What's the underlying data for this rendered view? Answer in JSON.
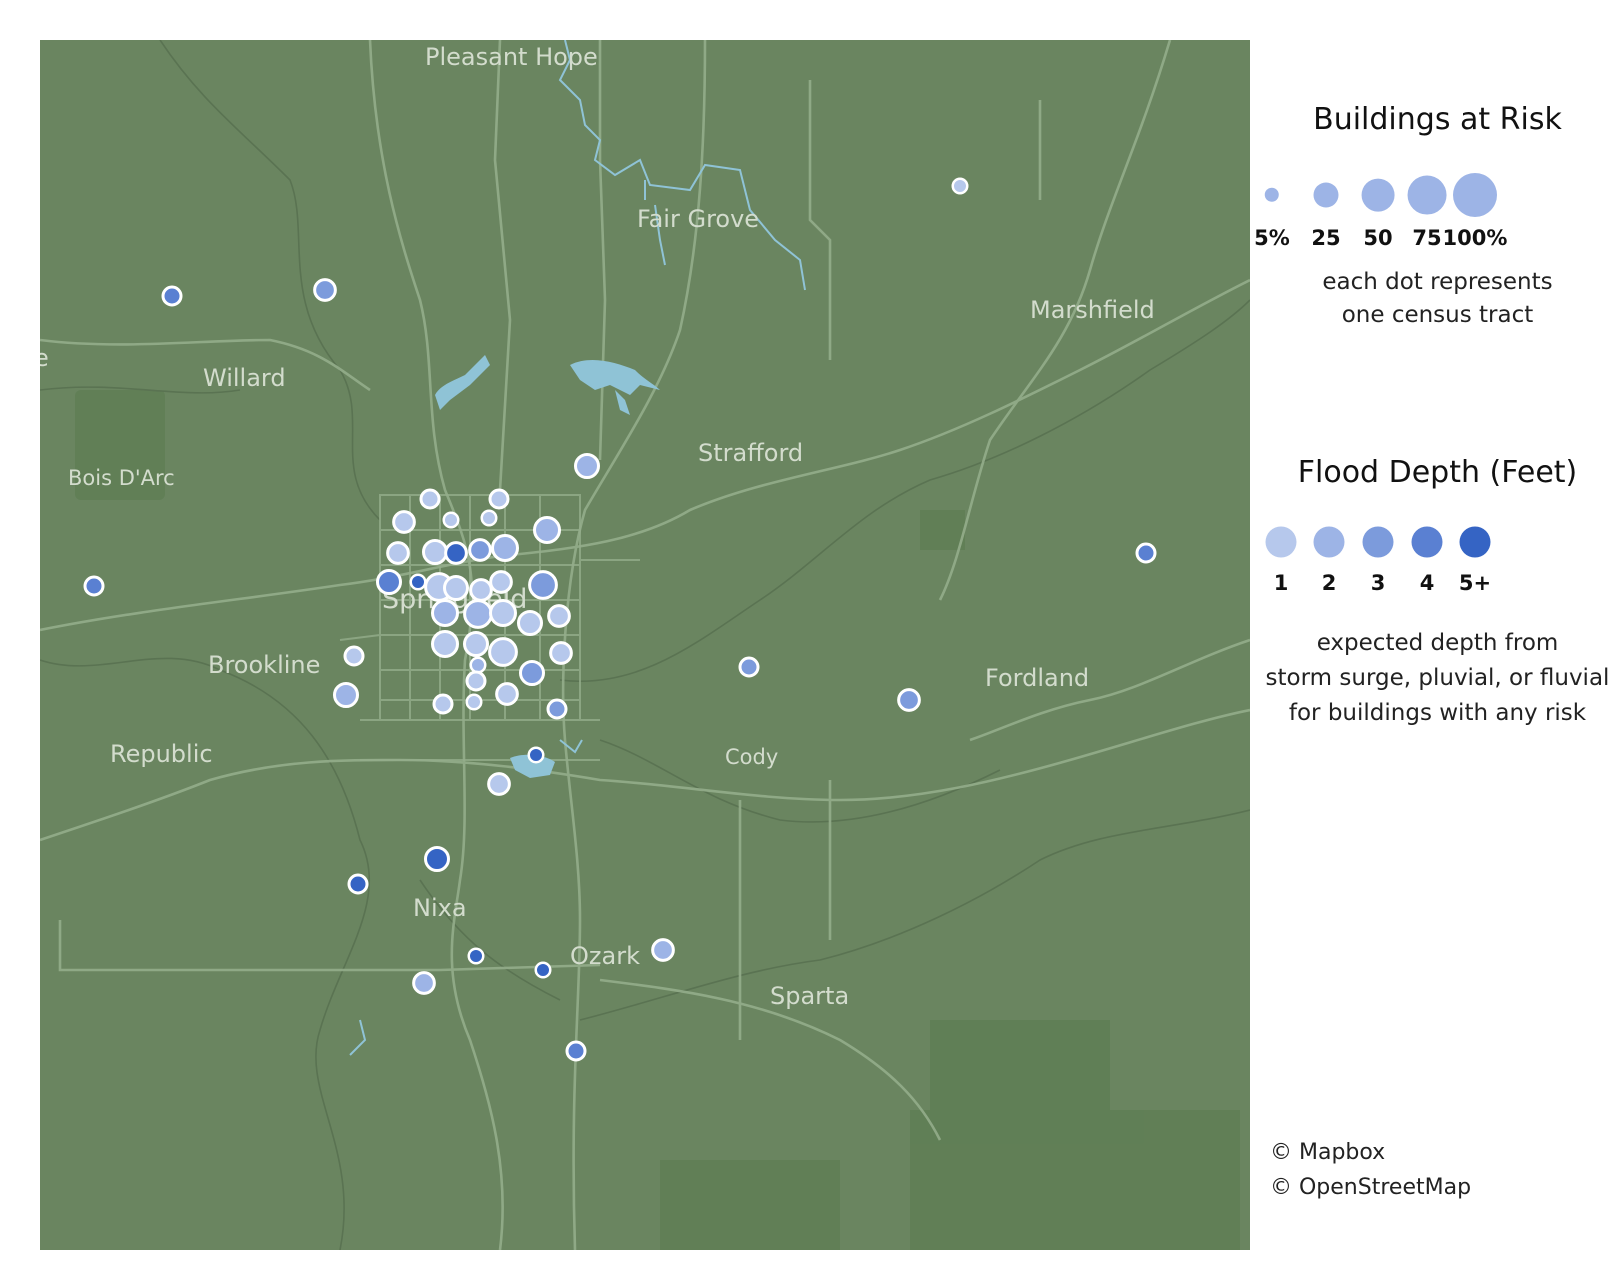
{
  "towns": [
    {
      "name": "Pleasant Hope"
    },
    {
      "name": "Fair Grove"
    },
    {
      "name": "Marshfield"
    },
    {
      "name": "Willard"
    },
    {
      "name": "Bois D'Arc"
    },
    {
      "name": "Strafford"
    },
    {
      "name": "Springfield"
    },
    {
      "name": "Brookline"
    },
    {
      "name": "Republic"
    },
    {
      "name": "Fordland"
    },
    {
      "name": "Cody"
    },
    {
      "name": "Nixa"
    },
    {
      "name": "Ozark"
    },
    {
      "name": "Sparta"
    },
    {
      "name": "e"
    }
  ],
  "map": {
    "background_color": "#6a8560",
    "road_color": "#9fb597",
    "water_color": "#8fc3d6",
    "park_color": "#5f7e55"
  },
  "legend": {
    "size": {
      "title": "Buildings at Risk",
      "labels": [
        "5%",
        "25",
        "50",
        "75",
        "100%"
      ],
      "values": [
        5,
        25,
        50,
        75,
        100
      ],
      "note_line1": "each dot represents",
      "note_line2": "one census tract"
    },
    "depth": {
      "title": "Flood Depth (Feet)",
      "labels": [
        "1",
        "2",
        "3",
        "4",
        "5+"
      ],
      "colors": [
        "#b6c8ec",
        "#9db4e6",
        "#7c9bdc",
        "#5a80d2",
        "#3564c4"
      ],
      "note_line1": "expected depth from",
      "note_line2": "storm surge, pluvial, or fluvial",
      "note_line3": "for buildings with any risk"
    }
  },
  "credits": {
    "mapbox": "© Mapbox",
    "osm": "© OpenStreetMap"
  },
  "tracts": [
    {
      "id": "t01",
      "risk_pct": 5,
      "depth": 1
    },
    {
      "id": "t02",
      "risk_pct": 10,
      "depth": 4
    },
    {
      "id": "t03",
      "risk_pct": 15,
      "depth": 3
    },
    {
      "id": "t04",
      "risk_pct": 10,
      "depth": 4
    },
    {
      "id": "t05",
      "risk_pct": 20,
      "depth": 2
    },
    {
      "id": "t06",
      "risk_pct": 10,
      "depth": 4
    },
    {
      "id": "t07",
      "risk_pct": 10,
      "depth": 1
    },
    {
      "id": "t08",
      "risk_pct": 10,
      "depth": 1
    },
    {
      "id": "t09",
      "risk_pct": 15,
      "depth": 1
    },
    {
      "id": "t10",
      "risk_pct": 5,
      "depth": 1
    },
    {
      "id": "t11",
      "risk_pct": 5,
      "depth": 1
    },
    {
      "id": "t12",
      "risk_pct": 25,
      "depth": 2
    },
    {
      "id": "t13",
      "risk_pct": 15,
      "depth": 1
    },
    {
      "id": "t14",
      "risk_pct": 20,
      "depth": 1
    },
    {
      "id": "t15",
      "risk_pct": 15,
      "depth": 5
    },
    {
      "id": "t16",
      "risk_pct": 15,
      "depth": 3
    },
    {
      "id": "t17",
      "risk_pct": 25,
      "depth": 2
    },
    {
      "id": "t18",
      "risk_pct": 20,
      "depth": 4
    },
    {
      "id": "t19",
      "risk_pct": 5,
      "depth": 5
    },
    {
      "id": "t20",
      "risk_pct": 30,
      "depth": 1
    },
    {
      "id": "t21",
      "risk_pct": 20,
      "depth": 1
    },
    {
      "id": "t22",
      "risk_pct": 15,
      "depth": 1
    },
    {
      "id": "t23",
      "risk_pct": 15,
      "depth": 1
    },
    {
      "id": "t24",
      "risk_pct": 30,
      "depth": 3
    },
    {
      "id": "t25",
      "risk_pct": 25,
      "depth": 2
    },
    {
      "id": "t26",
      "risk_pct": 30,
      "depth": 2
    },
    {
      "id": "t27",
      "risk_pct": 25,
      "depth": 1
    },
    {
      "id": "t28",
      "risk_pct": 20,
      "depth": 1
    },
    {
      "id": "t29",
      "risk_pct": 15,
      "depth": 1
    },
    {
      "id": "t30",
      "risk_pct": 10,
      "depth": 1
    },
    {
      "id": "t31",
      "risk_pct": 25,
      "depth": 1
    },
    {
      "id": "t32",
      "risk_pct": 20,
      "depth": 1
    },
    {
      "id": "t33",
      "risk_pct": 30,
      "depth": 1
    },
    {
      "id": "t34",
      "risk_pct": 15,
      "depth": 1
    },
    {
      "id": "t35",
      "risk_pct": 5,
      "depth": 2
    },
    {
      "id": "t36",
      "risk_pct": 20,
      "depth": 3
    },
    {
      "id": "t37",
      "risk_pct": 10,
      "depth": 1
    },
    {
      "id": "t38",
      "risk_pct": 20,
      "depth": 2
    },
    {
      "id": "t39",
      "risk_pct": 10,
      "depth": 1
    },
    {
      "id": "t40",
      "risk_pct": 5,
      "depth": 1
    },
    {
      "id": "t41",
      "risk_pct": 15,
      "depth": 1
    },
    {
      "id": "t42",
      "risk_pct": 10,
      "depth": 3
    },
    {
      "id": "t43",
      "risk_pct": 10,
      "depth": 3
    },
    {
      "id": "t44",
      "risk_pct": 15,
      "depth": 3
    },
    {
      "id": "t45",
      "risk_pct": 5,
      "depth": 5
    },
    {
      "id": "t46",
      "risk_pct": 15,
      "depth": 1
    },
    {
      "id": "t47",
      "risk_pct": 20,
      "depth": 5
    },
    {
      "id": "t48",
      "risk_pct": 10,
      "depth": 5
    },
    {
      "id": "t49",
      "risk_pct": 5,
      "depth": 5
    },
    {
      "id": "t50",
      "risk_pct": 5,
      "depth": 5
    },
    {
      "id": "t51",
      "risk_pct": 15,
      "depth": 2
    },
    {
      "id": "t52",
      "risk_pct": 15,
      "depth": 2
    },
    {
      "id": "t53",
      "risk_pct": 10,
      "depth": 4
    }
  ]
}
